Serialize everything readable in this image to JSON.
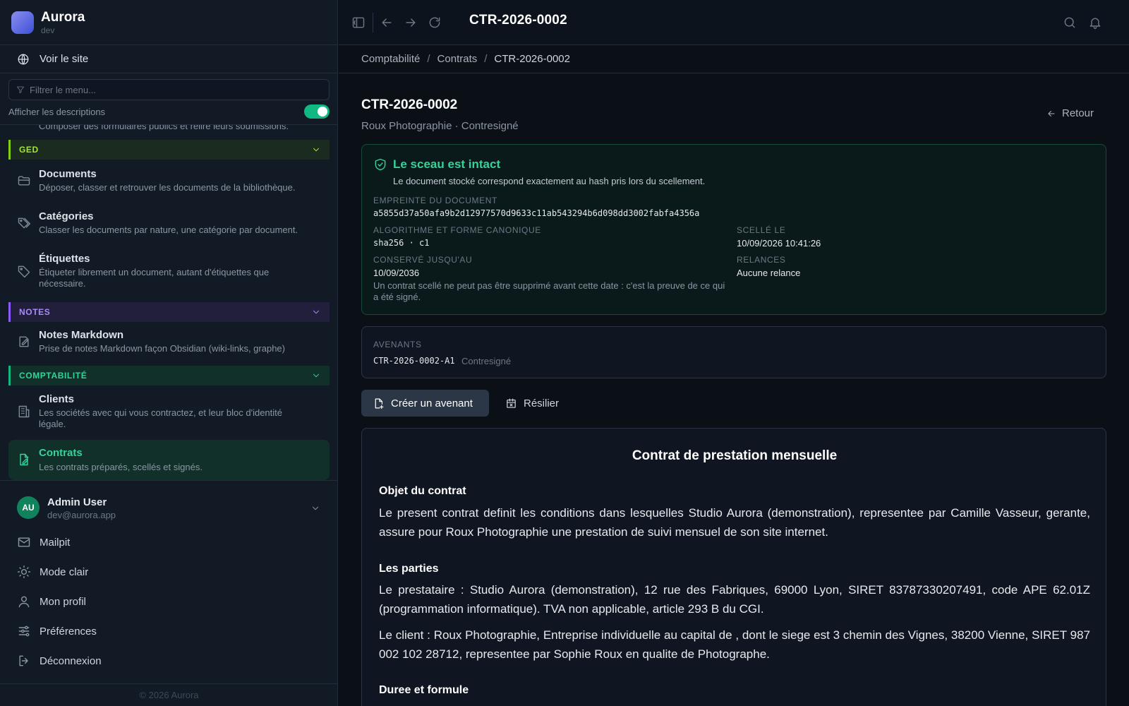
{
  "app": {
    "name": "Aurora",
    "env": "dev"
  },
  "sidebar": {
    "view_site": "Voir le site",
    "filter_placeholder": "Filtrer le menu...",
    "show_descriptions_label": "Afficher les descriptions",
    "show_descriptions": true,
    "partial_desc": "Composer des formulaires publics et relire leurs soumissions.",
    "sections": [
      {
        "label": "GED",
        "color": "#a3e635",
        "items": [
          {
            "title": "Documents",
            "desc": "Déposer, classer et retrouver les documents de la bibliothèque."
          },
          {
            "title": "Catégories",
            "desc": "Classer les documents par nature, une catégorie par document."
          },
          {
            "title": "Étiquettes",
            "desc": "Étiqueter librement un document, autant d'étiquettes que nécessaire."
          }
        ]
      },
      {
        "label": "NOTES",
        "color": "#a78bfa",
        "items": [
          {
            "title": "Notes Markdown",
            "desc": "Prise de notes Markdown façon Obsidian (wiki-links, graphe)"
          }
        ]
      },
      {
        "label": "COMPTABILITÉ",
        "color": "#34d399",
        "items": [
          {
            "title": "Clients",
            "desc": "Les sociétés avec qui vous contractez, et leur bloc d'identité légale."
          },
          {
            "title": "Contrats",
            "desc": "Les contrats préparés, scellés et signés.",
            "active": true
          }
        ]
      }
    ],
    "user": {
      "initials": "AU",
      "name": "Admin User",
      "email": "dev@aurora.app"
    },
    "user_menu": [
      "Mailpit",
      "Mode clair",
      "Mon profil",
      "Préférences",
      "Déconnexion"
    ],
    "copyright": "© 2026 Aurora"
  },
  "topbar": {
    "title": "CTR-2026-0002"
  },
  "breadcrumb": [
    "Comptabilité",
    "Contrats",
    "CTR-2026-0002"
  ],
  "page": {
    "title": "CTR-2026-0002",
    "subtitle": "Roux Photographie · Contresigné",
    "back_label": "Retour"
  },
  "seal": {
    "title": "Le sceau est intact",
    "desc": "Le document stocké correspond exactement au hash pris lors du scellement.",
    "fingerprint_label": "EMPREINTE DU DOCUMENT",
    "fingerprint": "a5855d37a50afa9b2d12977570d9633c11ab543294b6d098dd3002fabfa4356a",
    "algo_label": "ALGORITHME ET FORME CANONIQUE",
    "algo": "sha256 · c1",
    "sealed_label": "SCELLÉ LE",
    "sealed": "10/09/2026 10:41:26",
    "kept_label": "CONSERVÉ JUSQU'AU",
    "kept": "10/09/2036",
    "kept_note": "Un contrat scellé ne peut pas être supprimé avant cette date : c'est la preuve de ce qui a été signé.",
    "reminders_label": "RELANCES",
    "reminders": "Aucune relance"
  },
  "avenants": {
    "label": "AVENANTS",
    "items": [
      {
        "ref": "CTR-2026-0002-A1",
        "status": "Contresigné"
      }
    ]
  },
  "actions": {
    "create_amendment": "Créer un avenant",
    "terminate": "Résilier"
  },
  "contract": {
    "title": "Contrat de prestation mensuelle",
    "h_object": "Objet du contrat",
    "p_object": "Le present contrat definit les conditions dans lesquelles Studio Aurora (demonstration), representee par Camille Vasseur, gerante, assure pour Roux Photographie une prestation de suivi mensuel de son site internet.",
    "h_parties": "Les parties",
    "p_provider": "Le prestataire : Studio Aurora (demonstration), 12 rue des Fabriques, 69000 Lyon, SIRET 83787330207491, code APE 62.01Z (programmation informatique). TVA non applicable, article 293 B du CGI.",
    "p_client": "Le client : Roux Photographie, Entreprise individuelle au capital de , dont le siege est 3 chemin des Vignes, 38200 Vienne, SIRET 987 002 102 28712, representee par Sophie Roux en qualite de Photographe.",
    "h_duration": "Duree et formule"
  }
}
